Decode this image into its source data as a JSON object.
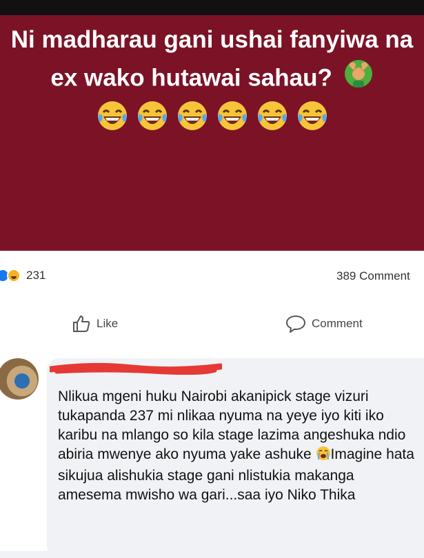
{
  "post": {
    "text": "Ni madharau gani ushai fanyiwa na ex wako hutawai sahau?",
    "inline_emoji": "person-gesturing-ok-icon",
    "emoji_row": [
      "laughing-tears-icon",
      "laughing-tears-icon",
      "laughing-tears-icon",
      "laughing-tears-icon",
      "laughing-tears-icon",
      "laughing-tears-icon"
    ],
    "background_color": "#7b1226"
  },
  "stats": {
    "reaction_count": "231",
    "comment_count": "389 Comment"
  },
  "actions": {
    "like_label": "Like",
    "comment_label": "Comment"
  },
  "comment": {
    "text_part1": "Nlikua mgeni huku Nairobi akanipick stage vizuri tukapanda 237  mi nlikaa nyuma na yeye  iyo kiti iko karibu na mlango so kila stage lazima angeshuka ndio abiria mwenye ako nyuma yake ashuke ",
    "text_emoji": "crying-face-icon",
    "text_part2": "Imagine hata sikujua alishukia stage gani nlistukia makanga amesema mwisho wa gari...saa iyo Niko Thika"
  }
}
